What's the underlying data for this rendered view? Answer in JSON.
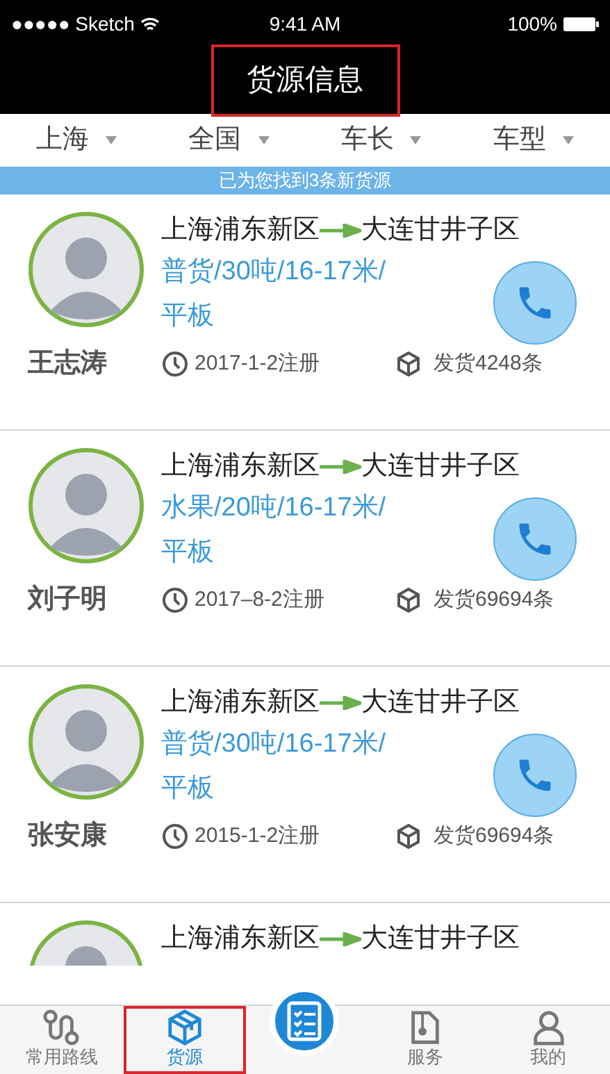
{
  "status_bar": {
    "carrier": "●●●●● Sketch",
    "time": "9:41 AM",
    "battery": "100%"
  },
  "header": {
    "title": "货源信息",
    "highlighted": true
  },
  "filters": [
    {
      "label": "上海"
    },
    {
      "label": "全国"
    },
    {
      "label": "车长"
    },
    {
      "label": "车型"
    }
  ],
  "banner": "已为您找到3条新货源",
  "listings": [
    {
      "name": "王志涛",
      "origin": "上海浦东新区",
      "destination": "大连甘井子区",
      "cargo": "普货/30吨/16-17米/平板",
      "registered": "2017-1-2注册",
      "shipments": "发货4248条"
    },
    {
      "name": "刘子明",
      "origin": "上海浦东新区",
      "destination": "大连甘井子区",
      "cargo": "水果/20吨/16-17米/平板",
      "registered": "2017–8-2注册",
      "shipments": "发货69694条"
    },
    {
      "name": "张安康",
      "origin": "上海浦东新区",
      "destination": "大连甘井子区",
      "cargo": "普货/30吨/16-17米/平板",
      "registered": "2015-1-2注册",
      "shipments": "发货69694条"
    },
    {
      "origin": "上海浦东新区",
      "destination": "大连甘井子区"
    }
  ],
  "tab_bar": [
    {
      "kind": "tab",
      "label": "常用路线",
      "selected": false,
      "highlighted": false
    },
    {
      "kind": "tab",
      "label": "货源",
      "selected": true,
      "highlighted": true
    },
    {
      "kind": "fab"
    },
    {
      "kind": "tab",
      "label": "服务",
      "selected": false,
      "highlighted": false
    },
    {
      "kind": "tab",
      "label": "我的",
      "selected": false,
      "highlighted": false
    }
  ]
}
